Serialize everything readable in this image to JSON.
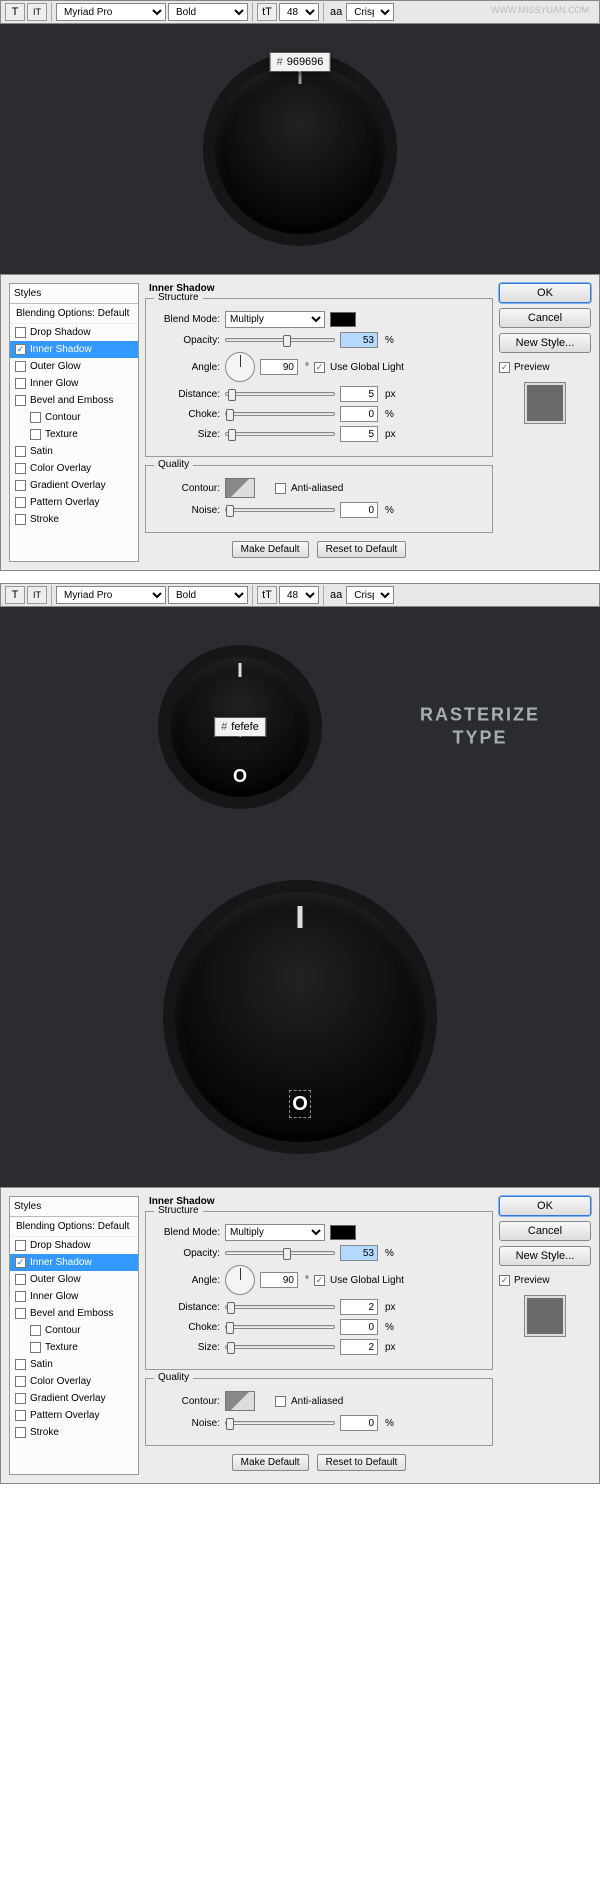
{
  "watermark": "WWW.MISSYUAN.COM",
  "toolbar": {
    "font": "Myriad Pro",
    "weight": "Bold",
    "size": "48 pt",
    "aa_label": "aa",
    "aa_value": "Crisp",
    "btn_T": "T",
    "btn_IT": "IT",
    "btn_tT": "tT"
  },
  "tips": {
    "hash": "#",
    "color1": "969696",
    "color2": "fefefe"
  },
  "rasterize": {
    "line1": "RASTERIZE",
    "line2": "TYPE"
  },
  "styles": {
    "header": "Styles",
    "blending": "Blending Options: Default",
    "items": [
      {
        "label": "Drop Shadow",
        "checked": false,
        "selected": false
      },
      {
        "label": "Inner Shadow",
        "checked": true,
        "selected": true
      },
      {
        "label": "Outer Glow",
        "checked": false,
        "selected": false
      },
      {
        "label": "Inner Glow",
        "checked": false,
        "selected": false
      },
      {
        "label": "Bevel and Emboss",
        "checked": false,
        "selected": false
      },
      {
        "label": "Contour",
        "checked": false,
        "selected": false,
        "indent": true
      },
      {
        "label": "Texture",
        "checked": false,
        "selected": false,
        "indent": true
      },
      {
        "label": "Satin",
        "checked": false,
        "selected": false
      },
      {
        "label": "Color Overlay",
        "checked": false,
        "selected": false
      },
      {
        "label": "Gradient Overlay",
        "checked": false,
        "selected": false
      },
      {
        "label": "Pattern Overlay",
        "checked": false,
        "selected": false
      },
      {
        "label": "Stroke",
        "checked": false,
        "selected": false
      }
    ]
  },
  "panel1": {
    "title": "Inner Shadow",
    "structure": "Structure",
    "quality": "Quality",
    "blend_label": "Blend Mode:",
    "blend_value": "Multiply",
    "opacity_label": "Opacity:",
    "opacity_value": "53",
    "pct": "%",
    "angle_label": "Angle:",
    "angle_value": "90",
    "deg": "°",
    "ugl": "Use Global Light",
    "distance_label": "Distance:",
    "distance_value": "5",
    "px": "px",
    "choke_label": "Choke:",
    "choke_value": "0",
    "size_label": "Size:",
    "size_value": "5",
    "contour_label": "Contour:",
    "anti_aliased": "Anti-aliased",
    "noise_label": "Noise:",
    "noise_value": "0",
    "make_default": "Make Default",
    "reset_default": "Reset to Default"
  },
  "panel2": {
    "distance_value": "2",
    "size_value": "2"
  },
  "right": {
    "ok": "OK",
    "cancel": "Cancel",
    "new_style": "New Style...",
    "preview": "Preview"
  }
}
